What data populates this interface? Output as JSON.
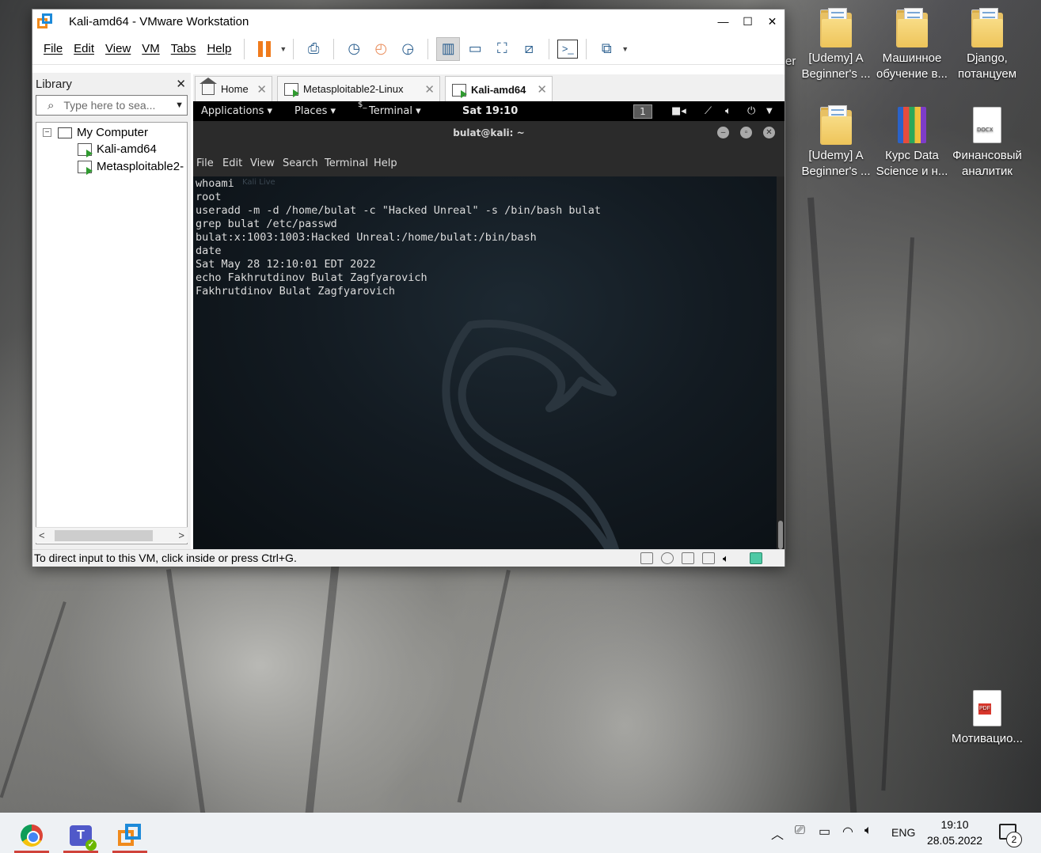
{
  "desktop": {
    "icons": [
      {
        "label_1": "[Udemy] A",
        "label_2": "Beginner's ..."
      },
      {
        "label_1": "Машинное",
        "label_2": "обучение в..."
      },
      {
        "label_1": "Django,",
        "label_2": "потанцуем"
      },
      {
        "label_1": "[Udemy] A",
        "label_2": "Beginner's ..."
      },
      {
        "label_1": "Курс Data",
        "label_2": "Science и н..."
      },
      {
        "label_1": "Финансовый",
        "label_2": "аналитик"
      },
      {
        "label_1": "Мотивацио...",
        "label_2": ""
      }
    ],
    "partial_label": "er",
    "docx_badge": "DOCX",
    "pdf_badge": "PDF"
  },
  "vmware": {
    "title": "Kali-amd64 - VMware Workstation",
    "menu": [
      "File",
      "Edit",
      "View",
      "VM",
      "Tabs",
      "Help"
    ],
    "library": {
      "title": "Library",
      "search_placeholder": "Type here to sea...",
      "tree": {
        "root": "My Computer",
        "children": [
          "Kali-amd64",
          "Metasploitable2-"
        ]
      }
    },
    "tabs": [
      "Home",
      "Metasploitable2-Linux",
      "Kali-amd64"
    ],
    "status_text": "To direct input to this VM, click inside or press Ctrl+G."
  },
  "kali": {
    "panel": {
      "applications": "Applications ▾",
      "places": "Places ▾",
      "terminal": "Terminal ▾",
      "clock": "Sat 19:10",
      "workspace": "1"
    },
    "terminal": {
      "title": "bulat@kali: ~",
      "menu": [
        "File",
        "Edit",
        "View",
        "Search",
        "Terminal",
        "Help"
      ],
      "watermark": "Kali Live",
      "lines": [
        "whoami",
        "root",
        "useradd -m -d /home/bulat -c \"Hacked Unreal\" -s /bin/bash bulat",
        "grep bulat /etc/passwd",
        "bulat:x:1003:1003:Hacked Unreal:/home/bulat:/bin/bash",
        "date",
        "Sat May 28 12:10:01 EDT 2022",
        "echo Fakhrutdinov Bulat Zagfyarovich",
        "Fakhrutdinov Bulat Zagfyarovich"
      ]
    }
  },
  "taskbar": {
    "language": "ENG",
    "time": "19:10",
    "date": "28.05.2022",
    "notifications": "2"
  },
  "colors": {
    "vmware_orange": "#f07b1c",
    "vmware_blue": "#1d8ad9",
    "kali_background": "#131b22"
  }
}
